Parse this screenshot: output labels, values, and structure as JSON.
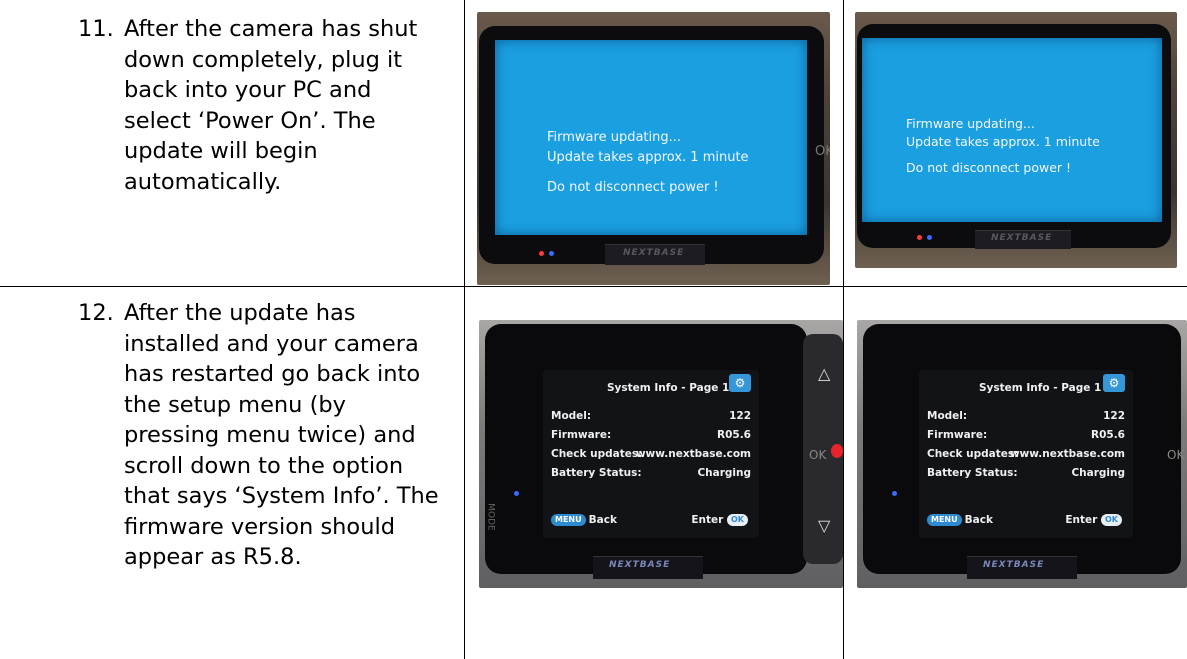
{
  "steps": [
    {
      "number": "11.",
      "lines": [
        "After the camera has shut",
        "down completely, plug it",
        "back into your PC and",
        "select ‘Power On’. The",
        "update will begin",
        "automatically."
      ]
    },
    {
      "number": "12.",
      "lines": [
        "After the update has",
        "installed and your camera",
        "has restarted go back into",
        "the setup menu (by",
        "pressing menu twice) and",
        "scroll down to the option",
        "that says ‘System Info’. The",
        "firmware version should",
        "appear as R5.8."
      ]
    }
  ],
  "firmware_screen": {
    "line1": "Firmware updating...",
    "line2": "Update takes approx. 1 minute",
    "line3": "Do not disconnect power !",
    "brand": "NEXTBASE",
    "side_label": "OK"
  },
  "system_info": {
    "title": "System Info - Page 1",
    "rows": [
      {
        "label": "Model:",
        "value": "122"
      },
      {
        "label": "Firmware:",
        "value": "R05.6"
      },
      {
        "label": "Check updates:",
        "value": "www.nextbase.com"
      },
      {
        "label": "Battery Status:",
        "value": "Charging"
      }
    ],
    "menu_key": "MENU",
    "back": "Back",
    "enter": "Enter",
    "ok_key": "OK",
    "brand": "NEXTBASE",
    "side_label": "OK",
    "mode_label": "MODE"
  },
  "colors": {
    "firmware_screen": "#1a9fe0",
    "gear_badge": "#3596d8",
    "record_button": "#e8242a"
  }
}
